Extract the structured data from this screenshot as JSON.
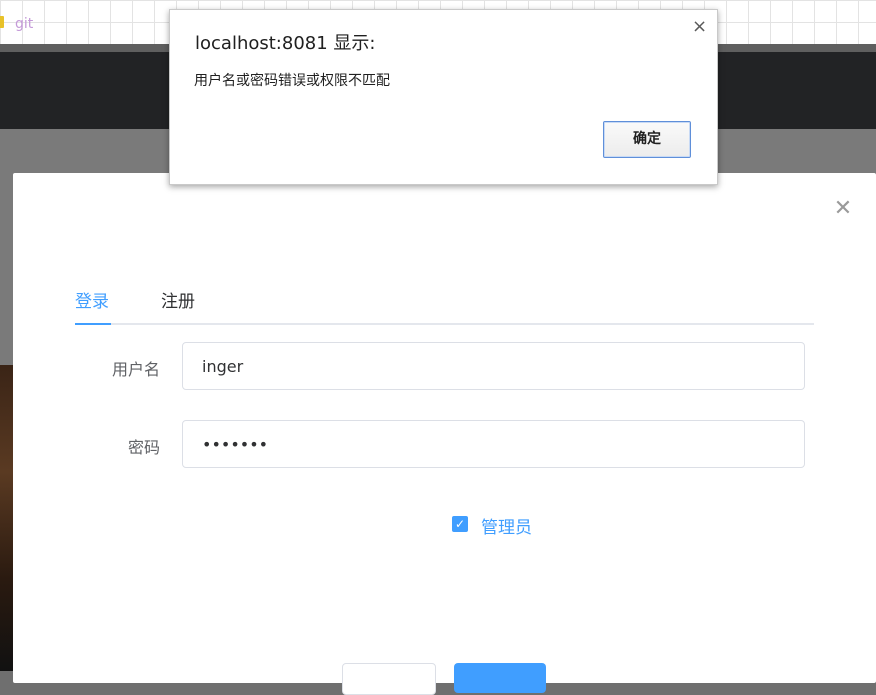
{
  "bookmarks": {
    "item_label": "git",
    "folder_icon": "folder-icon"
  },
  "alert": {
    "title": "localhost:8081 显示:",
    "message": "用户名或密码错误或权限不匹配",
    "ok_label": "确定",
    "close_glyph": "×"
  },
  "dialog": {
    "close_glyph": "✕",
    "tabs": [
      {
        "label": "登录",
        "active": true
      },
      {
        "label": "注册",
        "active": false
      }
    ],
    "username": {
      "label": "用户名",
      "value": "inger"
    },
    "password": {
      "label": "密码",
      "value": "•••••••"
    },
    "admin_checkbox": {
      "label": "管理员",
      "checked": true,
      "check_glyph": "✓"
    }
  },
  "colors": {
    "accent": "#409eff",
    "header": "#222325",
    "overlay": "#7a7a7a"
  }
}
